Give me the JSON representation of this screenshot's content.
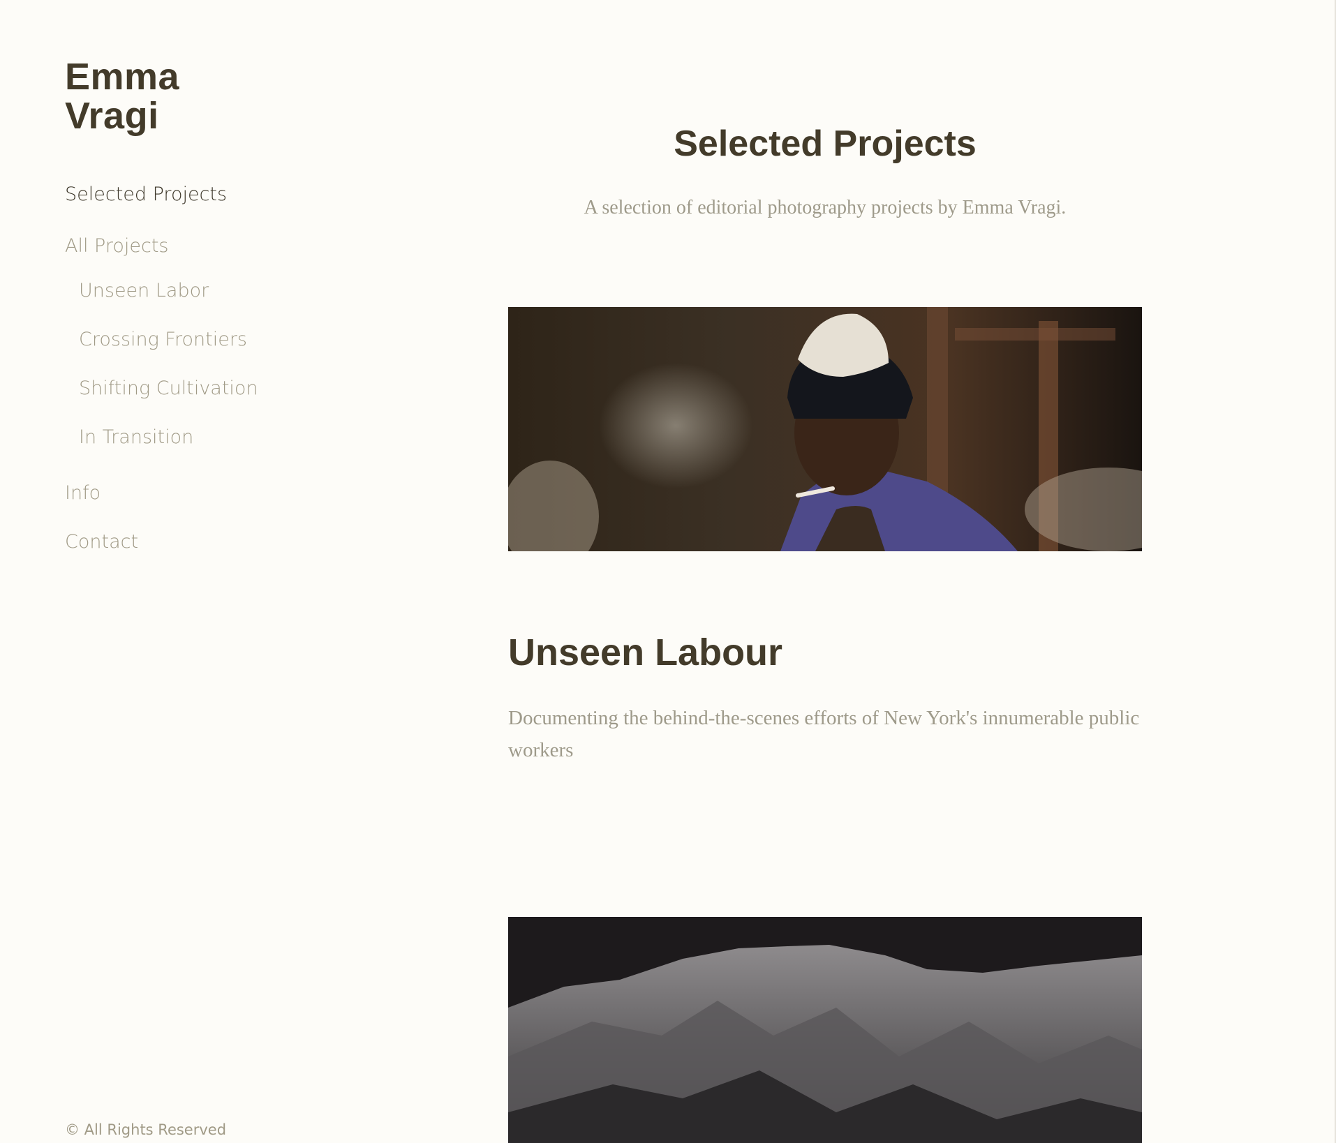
{
  "sidebar": {
    "title_line1": "Emma",
    "title_line2": "Vragi",
    "nav": {
      "selected_projects": "Selected Projects",
      "all_projects": "All Projects",
      "sub_items": [
        "Unseen Labor",
        "Crossing Frontiers",
        "Shifting Cultivation",
        "In Transition"
      ],
      "info": "Info",
      "contact": "Contact"
    },
    "copyright": "© All Rights Reserved"
  },
  "main": {
    "heading": "Selected Projects",
    "subheading": "A selection of editorial photography projects by Emma Vragi.",
    "projects": [
      {
        "title": "Unseen Labour",
        "description": "Documenting the behind-the-scenes efforts of New York's innumerable public workers"
      }
    ]
  },
  "colors": {
    "background": "#fdfcf8",
    "heading": "#433b2a",
    "nav_active": "#3c3628",
    "muted": "#a09a86"
  }
}
